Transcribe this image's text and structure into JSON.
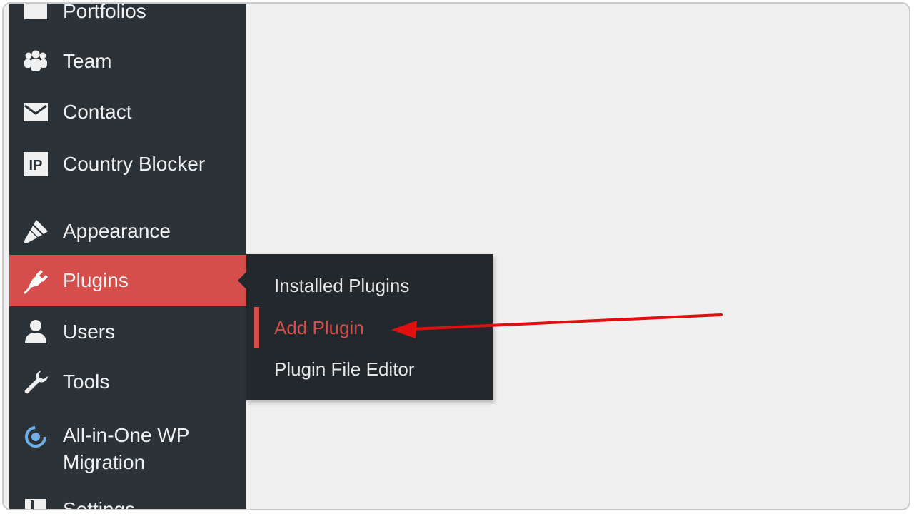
{
  "sidebar": {
    "items": [
      {
        "label": "Portfolios",
        "icon": "portfolio-icon"
      },
      {
        "label": "Team",
        "icon": "team-icon"
      },
      {
        "label": "Contact",
        "icon": "envelope-icon"
      },
      {
        "label": "Country Blocker",
        "icon": "ip-icon"
      },
      {
        "label": "Appearance",
        "icon": "brush-icon"
      },
      {
        "label": "Plugins",
        "icon": "plugin-icon",
        "active": true
      },
      {
        "label": "Users",
        "icon": "user-icon"
      },
      {
        "label": "Tools",
        "icon": "wrench-icon"
      },
      {
        "label_line1": "All-in-One WP",
        "label_line2": "Migration",
        "icon": "migration-icon"
      },
      {
        "label": "Settings",
        "icon": "settings-icon"
      }
    ]
  },
  "submenu": {
    "items": [
      {
        "label": "Installed Plugins"
      },
      {
        "label": "Add Plugin",
        "current": true
      },
      {
        "label": "Plugin File Editor"
      }
    ]
  },
  "colors": {
    "sidebar_bg": "#2c3338",
    "submenu_bg": "#23282d",
    "accent": "#d54e4b",
    "content_bg": "#f0f0f1",
    "annotation_arrow": "#e01010"
  }
}
